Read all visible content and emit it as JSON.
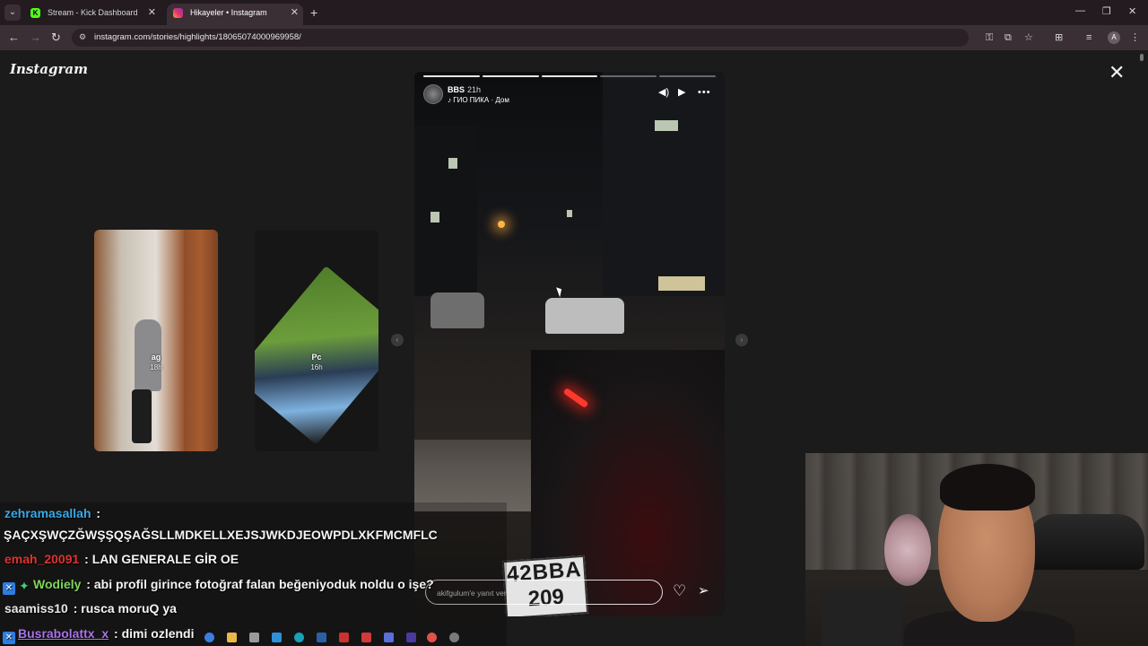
{
  "browser": {
    "tabs": [
      {
        "title": "Stream - Kick Dashboard",
        "active": false,
        "favicon": "kick-icon"
      },
      {
        "title": "Hikayeler • Instagram",
        "active": true,
        "favicon": "instagram-icon"
      }
    ],
    "url": "instagram.com/stories/highlights/18065074000969958/",
    "profile_initial": "A"
  },
  "instagram": {
    "logo": "Instagram",
    "previews": [
      {
        "name": "ag",
        "time": "18h"
      },
      {
        "name": "Pc",
        "time": "16h"
      }
    ],
    "story": {
      "username": "BBS",
      "time": "21h",
      "music": "ГИО ПИКА · Дом",
      "progress_segments": 5,
      "progress_completed": 3,
      "plate_line1": "42BBA",
      "plate_line2": "209",
      "reply_placeholder": "akifgulum'e yanıt ver..."
    }
  },
  "chat": {
    "messages": [
      {
        "user": "zehramasallah",
        "color": "#3ba9e6",
        "text": "ŞAÇXŞWÇZĞWŞŞQŞAĞSLLMDKELLXEJSJWKDJEOWPDLXKFMCMFLC",
        "badges": []
      },
      {
        "user": "emah_20091",
        "color": "#e0322f",
        "text": "LAN GENERALE GİR OE",
        "badges": []
      },
      {
        "user": "Wodiely",
        "color": "#7fd65b",
        "text": "abi profil girince fotoğraf falan beğeniyoduk noldu o işe?",
        "badges": [
          "blue",
          "green"
        ]
      },
      {
        "user": "saamiss10",
        "color": "#e8e8e8",
        "text": "rusca moruQ ya",
        "badges": []
      },
      {
        "user": "Busrabolattx_x",
        "color": "#a974e8",
        "text": "dimi ozlendi",
        "badges": [
          "blue"
        ]
      }
    ]
  },
  "colors": {
    "tab_active": "#3b2f36",
    "tabbar": "#231b20",
    "viewer_bg": "#1b1b1b",
    "kick_green": "#53fc18"
  }
}
